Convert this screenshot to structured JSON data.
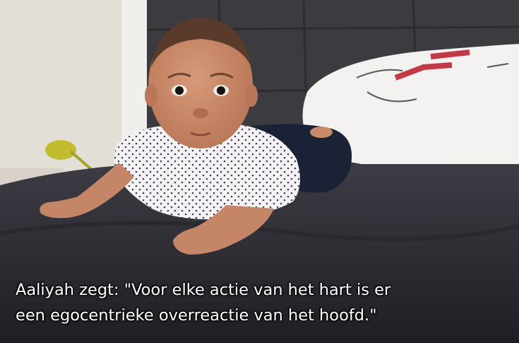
{
  "caption": {
    "line1": "Aaliyah zegt: \"Voor elke actie van het hart is er",
    "line2": "een egocentrieke overreactie van het hoofd.\""
  },
  "colors": {
    "wall": "#e6e1d9",
    "headboard": "#3a3a3f",
    "blanket": "#34333a",
    "pillow": "#f2f1ef",
    "onesie": "#f4f2f4",
    "pants": "#1c2134",
    "skin": "#c98a6a",
    "lamp": "#b9b427",
    "caption_text": "#ffffff"
  }
}
